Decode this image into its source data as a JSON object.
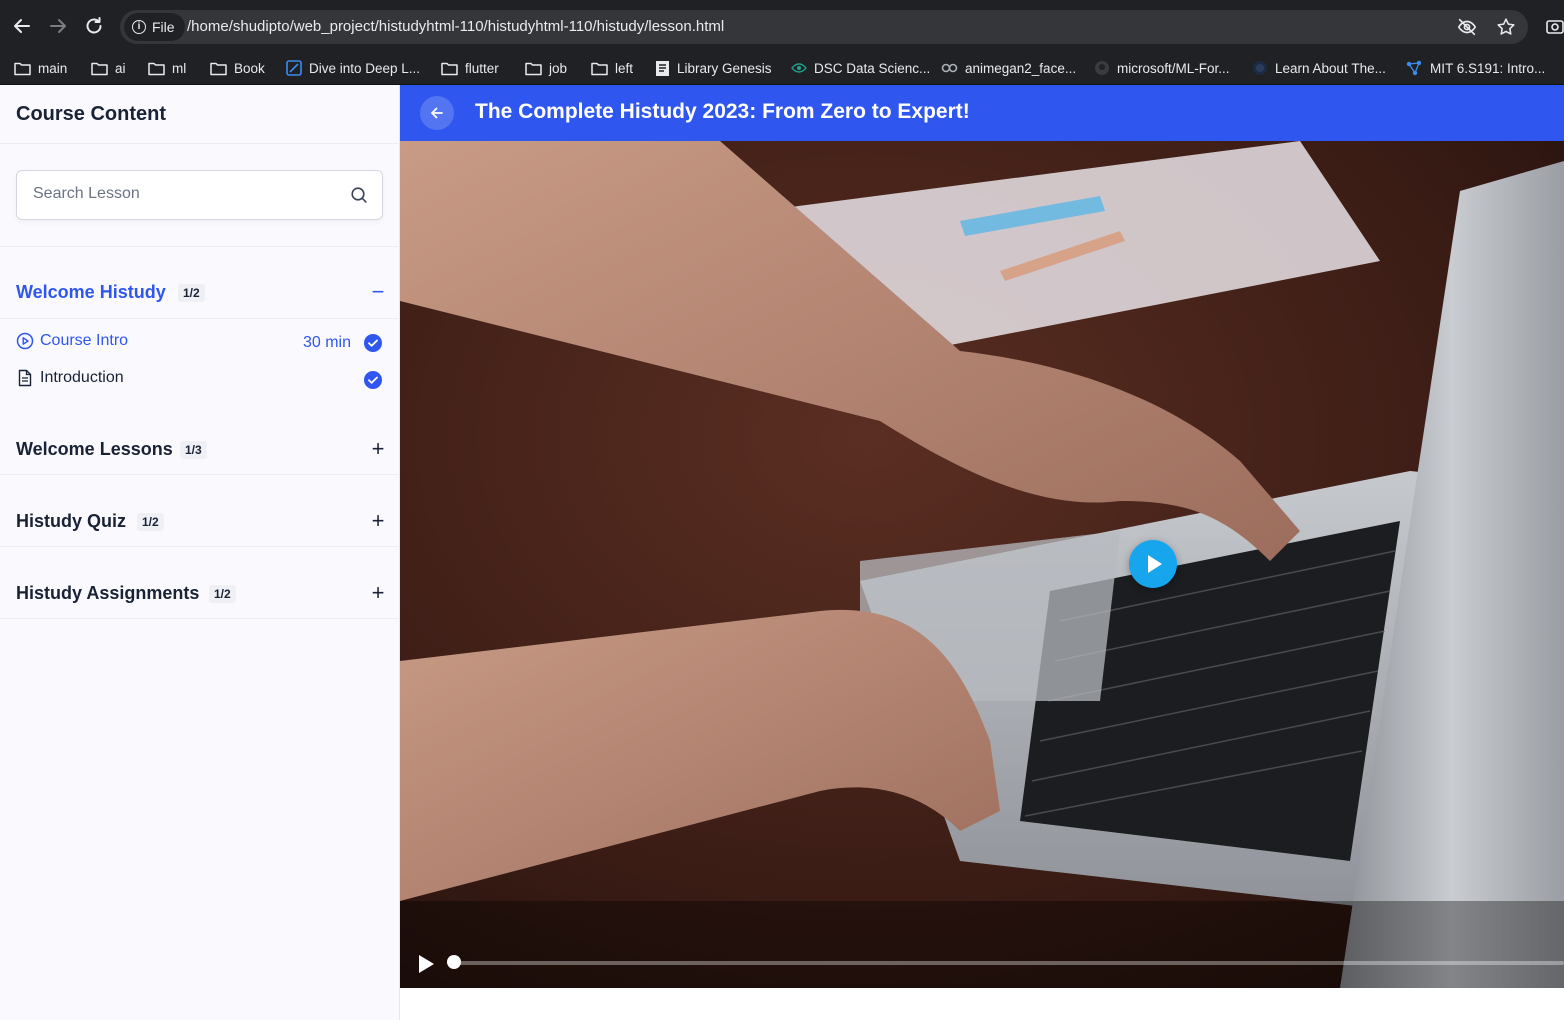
{
  "browser": {
    "back_icon": "arrow-left-icon",
    "forward_icon": "arrow-right-icon",
    "reload_icon": "reload-icon",
    "site_chip_label": "File",
    "url": "/home/shudipto/web_project/histudyhtml-110/histudyhtml-110/histudy/lesson.html",
    "bookmarks": [
      {
        "label": "main",
        "icon": "folder-icon"
      },
      {
        "label": "ai",
        "icon": "folder-icon"
      },
      {
        "label": "ml",
        "icon": "folder-icon"
      },
      {
        "label": "Book",
        "icon": "folder-icon"
      },
      {
        "label": "Dive into Deep L...",
        "icon": "d2l-icon"
      },
      {
        "label": "flutter",
        "icon": "folder-icon"
      },
      {
        "label": "job",
        "icon": "folder-icon"
      },
      {
        "label": "left",
        "icon": "folder-icon"
      },
      {
        "label": "Library Genesis",
        "icon": "book-icon"
      },
      {
        "label": "DSC Data Scienc...",
        "icon": "eye-icon"
      },
      {
        "label": "animegan2_face...",
        "icon": "colab-icon"
      },
      {
        "label": "microsoft/ML-For...",
        "icon": "github-icon"
      },
      {
        "label": "Learn About The...",
        "icon": "globe-icon"
      },
      {
        "label": "MIT 6.S191: Intro...",
        "icon": "network-icon"
      }
    ]
  },
  "sidebar": {
    "title": "Course Content",
    "search_placeholder": "Search Lesson",
    "sections": [
      {
        "title": "Welcome Histudy",
        "count": "1/2",
        "expanded": true,
        "toggle": "−",
        "lessons": [
          {
            "label": "Course Intro",
            "icon": "play-circle-icon",
            "time": "30 min",
            "completed": true
          },
          {
            "label": "Introduction",
            "icon": "document-icon",
            "time": "",
            "completed": true
          }
        ]
      },
      {
        "title": "Welcome Lessons",
        "count": "1/3",
        "expanded": false,
        "toggle": "+"
      },
      {
        "title": "Histudy Quiz",
        "count": "1/2",
        "expanded": false,
        "toggle": "+"
      },
      {
        "title": "Histudy Assignments",
        "count": "1/2",
        "expanded": false,
        "toggle": "+"
      }
    ]
  },
  "main": {
    "course_title": "The Complete Histudy 2023: From Zero to Expert!",
    "video": {
      "progress": 0.0,
      "state": "paused"
    }
  },
  "colors": {
    "primary": "#2f57ef",
    "play_button": "#17a6ee",
    "sidebar_bg": "#f9f9fe",
    "browser_chrome": "#202124"
  }
}
